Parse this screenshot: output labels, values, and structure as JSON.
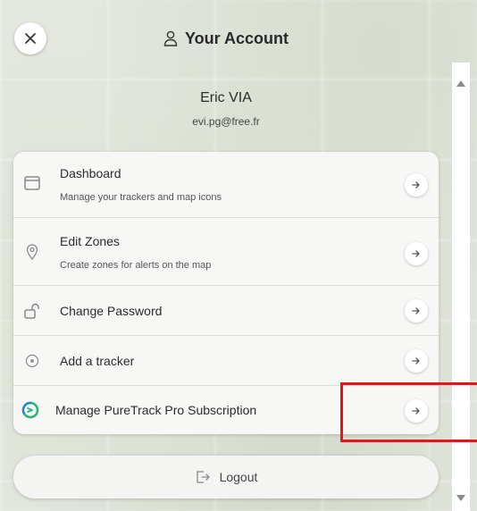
{
  "header": {
    "title": "Your Account",
    "user_icon": "user-icon",
    "close_icon": "close-icon"
  },
  "user": {
    "name": "Eric VIA",
    "email": "evi.pg@free.fr"
  },
  "menu": {
    "items": [
      {
        "label": "Dashboard",
        "description": "Manage your trackers and map icons",
        "icon": "dashboard-icon"
      },
      {
        "label": "Edit Zones",
        "description": "Create zones for alerts on the map",
        "icon": "location-pin-icon"
      },
      {
        "label": "Change Password",
        "description": "",
        "icon": "unlock-icon"
      },
      {
        "label": "Add a tracker",
        "description": "",
        "icon": "add-circle-icon"
      },
      {
        "label": "Manage PureTrack Pro Subscription",
        "description": "",
        "icon": "puretrack-logo-icon"
      }
    ],
    "arrow_icon": "arrow-right-icon"
  },
  "logout": {
    "label": "Logout",
    "icon": "logout-icon"
  },
  "colors": {
    "highlight": "#e8141c",
    "card_background": "#f7f8f6",
    "accent_green": "#2bb673",
    "accent_blue": "#1e88c8"
  }
}
